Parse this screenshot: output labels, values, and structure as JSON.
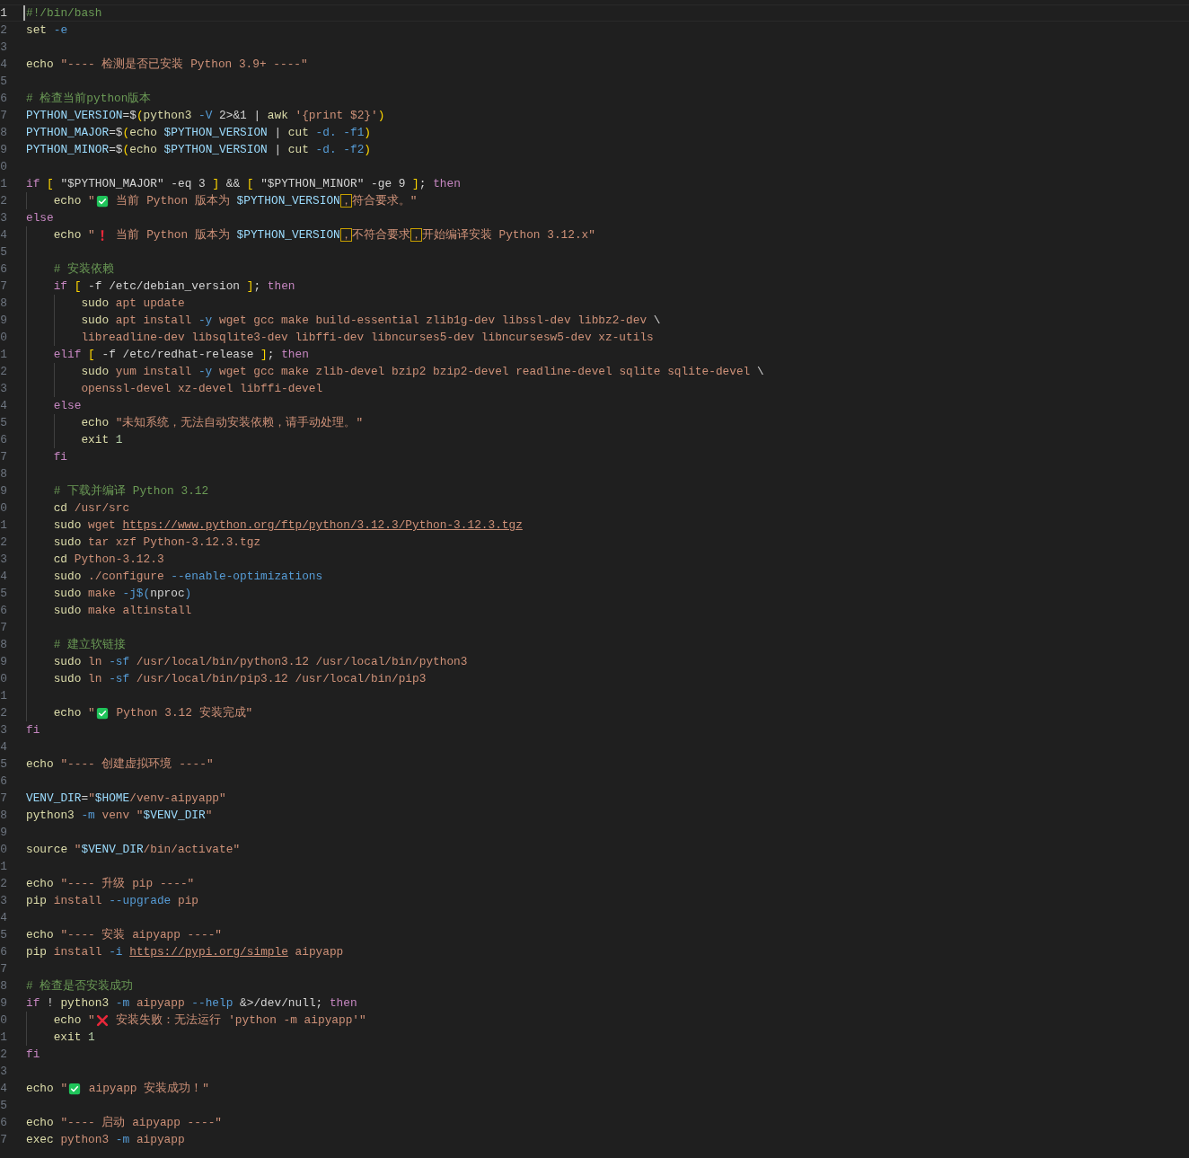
{
  "editor": {
    "lines": [
      {
        "number": "1",
        "current": true,
        "tokens": [
          {
            "kind": "comment",
            "text": "#!/bin/bash"
          }
        ]
      },
      {
        "number": "2",
        "tokens": [
          {
            "kind": "command",
            "text": "set "
          },
          {
            "kind": "option",
            "text": "-e"
          }
        ]
      },
      {
        "number": "3"
      },
      {
        "number": "4",
        "tokens": [
          {
            "kind": "command",
            "text": "echo "
          },
          {
            "kind": "string",
            "text": "\"---- 检测是否已安装 Python 3.9+ ----\""
          }
        ]
      },
      {
        "number": "5"
      },
      {
        "number": "6",
        "tokens": [
          {
            "kind": "comment",
            "text": "# 检查当前python版本"
          }
        ]
      },
      {
        "number": "7",
        "tokens": [
          {
            "kind": "variable",
            "text": "PYTHON_VERSION"
          },
          {
            "kind": "plain",
            "text": "=$"
          },
          {
            "kind": "bracket",
            "text": "("
          },
          {
            "kind": "command",
            "text": "python3 "
          },
          {
            "kind": "option",
            "text": "-V"
          },
          {
            "kind": "plain",
            "text": " 2>&1 | "
          },
          {
            "kind": "command",
            "text": "awk "
          },
          {
            "kind": "string",
            "text": "'{print $2}'"
          },
          {
            "kind": "bracket",
            "text": ")"
          }
        ]
      },
      {
        "number": "8",
        "tokens": [
          {
            "kind": "variable",
            "text": "PYTHON_MAJOR"
          },
          {
            "kind": "plain",
            "text": "=$"
          },
          {
            "kind": "bracket",
            "text": "("
          },
          {
            "kind": "command",
            "text": "echo "
          },
          {
            "kind": "variable",
            "text": "$PYTHON_VERSION"
          },
          {
            "kind": "plain",
            "text": " | "
          },
          {
            "kind": "command",
            "text": "cut "
          },
          {
            "kind": "option",
            "text": "-d. -f1"
          },
          {
            "kind": "bracket",
            "text": ")"
          }
        ]
      },
      {
        "number": "9",
        "tokens": [
          {
            "kind": "variable",
            "text": "PYTHON_MINOR"
          },
          {
            "kind": "plain",
            "text": "=$"
          },
          {
            "kind": "bracket",
            "text": "("
          },
          {
            "kind": "command",
            "text": "echo "
          },
          {
            "kind": "variable",
            "text": "$PYTHON_VERSION"
          },
          {
            "kind": "plain",
            "text": " | "
          },
          {
            "kind": "command",
            "text": "cut "
          },
          {
            "kind": "option",
            "text": "-d. -f2"
          },
          {
            "kind": "bracket",
            "text": ")"
          }
        ]
      },
      {
        "number": "0"
      },
      {
        "number": "1",
        "tokens": [
          {
            "kind": "keyword",
            "text": "if "
          },
          {
            "kind": "bracket",
            "text": "["
          },
          {
            "kind": "plain",
            "text": " \"$PYTHON_MAJOR\" -eq 3 "
          },
          {
            "kind": "bracket",
            "text": "]"
          },
          {
            "kind": "plain",
            "text": " && "
          },
          {
            "kind": "bracket",
            "text": "["
          },
          {
            "kind": "plain",
            "text": " \"$PYTHON_MINOR\" -ge 9 "
          },
          {
            "kind": "bracket",
            "text": "]"
          },
          {
            "kind": "plain",
            "text": "; "
          },
          {
            "kind": "keyword",
            "text": "then"
          }
        ],
        "children": [
          {
            "number": "2",
            "tokens": [
              {
                "kind": "command",
                "text": "echo "
              },
              {
                "kind": "string",
                "text": "\""
              },
              {
                "kind": "check_emoji"
              },
              {
                "kind": "string",
                "text": " 当前 Python 版本为 "
              },
              {
                "kind": "variable",
                "text": "$PYTHON_VERSION"
              },
              {
                "kind": "ambiguous",
                "text": "，"
              },
              {
                "kind": "string",
                "text": "符合要求。\""
              }
            ]
          }
        ]
      },
      {
        "number": "3",
        "tokens": [
          {
            "kind": "keyword",
            "text": "else"
          }
        ],
        "children": [
          {
            "number": "4",
            "tokens": [
              {
                "kind": "command",
                "text": "echo "
              },
              {
                "kind": "string",
                "text": "\""
              },
              {
                "kind": "exclaim_emoji"
              },
              {
                "kind": "string",
                "text": " 当前 Python 版本为 "
              },
              {
                "kind": "variable",
                "text": "$PYTHON_VERSION"
              },
              {
                "kind": "ambiguous",
                "text": "，"
              },
              {
                "kind": "string",
                "text": "不符合要求"
              },
              {
                "kind": "ambiguous",
                "text": "，"
              },
              {
                "kind": "string",
                "text": "开始编译安装 Python 3.12.x\""
              }
            ]
          },
          {
            "number": "5"
          },
          {
            "number": "6",
            "tokens": [
              {
                "kind": "comment",
                "text": "# 安装依赖"
              }
            ]
          },
          {
            "number": "7",
            "tokens": [
              {
                "kind": "keyword",
                "text": "if "
              },
              {
                "kind": "bracket",
                "text": "["
              },
              {
                "kind": "plain",
                "text": " -f /etc/debian_version "
              },
              {
                "kind": "bracket",
                "text": "]"
              },
              {
                "kind": "plain",
                "text": "; "
              },
              {
                "kind": "keyword",
                "text": "then"
              }
            ],
            "children": [
              {
                "number": "8",
                "tokens": [
                  {
                    "kind": "command",
                    "text": "sudo"
                  },
                  {
                    "kind": "string",
                    "text": " apt update"
                  }
                ]
              },
              {
                "number": "9",
                "tokens": [
                  {
                    "kind": "command",
                    "text": "sudo"
                  },
                  {
                    "kind": "string",
                    "text": " apt install "
                  },
                  {
                    "kind": "option",
                    "text": "-y"
                  },
                  {
                    "kind": "string",
                    "text": " wget gcc make build-essential zlib1g-dev libssl-dev libbz2-dev "
                  },
                  {
                    "kind": "plain",
                    "text": "\\"
                  }
                ]
              },
              {
                "number": "0",
                "tokens": [
                  {
                    "kind": "string",
                    "text": "libreadline-dev libsqlite3-dev libffi-dev libncurses5-dev libncursesw5-dev xz-utils"
                  }
                ]
              }
            ]
          },
          {
            "number": "1",
            "tokens": [
              {
                "kind": "keyword",
                "text": "elif "
              },
              {
                "kind": "bracket",
                "text": "["
              },
              {
                "kind": "plain",
                "text": " -f /etc/redhat-release "
              },
              {
                "kind": "bracket",
                "text": "]"
              },
              {
                "kind": "plain",
                "text": "; "
              },
              {
                "kind": "keyword",
                "text": "then"
              }
            ],
            "children": [
              {
                "number": "2",
                "tokens": [
                  {
                    "kind": "command",
                    "text": "sudo"
                  },
                  {
                    "kind": "string",
                    "text": " yum install "
                  },
                  {
                    "kind": "option",
                    "text": "-y"
                  },
                  {
                    "kind": "string",
                    "text": " wget gcc make zlib-devel bzip2 bzip2-devel readline-devel sqlite sqlite-devel "
                  },
                  {
                    "kind": "plain",
                    "text": "\\"
                  }
                ]
              },
              {
                "number": "3",
                "tokens": [
                  {
                    "kind": "string",
                    "text": "openssl-devel xz-devel libffi-devel"
                  }
                ]
              }
            ]
          },
          {
            "number": "4",
            "tokens": [
              {
                "kind": "keyword",
                "text": "else"
              }
            ],
            "children": [
              {
                "number": "5",
                "tokens": [
                  {
                    "kind": "command",
                    "text": "echo "
                  },
                  {
                    "kind": "string",
                    "text": "\"未知系统，无法自动安装依赖，请手动处理。\""
                  }
                ]
              },
              {
                "number": "6",
                "tokens": [
                  {
                    "kind": "command",
                    "text": "exit "
                  },
                  {
                    "kind": "number",
                    "text": "1"
                  }
                ]
              }
            ]
          },
          {
            "number": "7",
            "tokens": [
              {
                "kind": "keyword",
                "text": "fi"
              }
            ]
          },
          {
            "number": "8"
          },
          {
            "number": "9",
            "tokens": [
              {
                "kind": "comment",
                "text": "# 下载并编译 Python 3.12"
              }
            ]
          },
          {
            "number": "0",
            "tokens": [
              {
                "kind": "command",
                "text": "cd"
              },
              {
                "kind": "string",
                "text": " /usr/src"
              }
            ]
          },
          {
            "number": "1",
            "tokens": [
              {
                "kind": "command",
                "text": "sudo"
              },
              {
                "kind": "string",
                "text": " wget "
              },
              {
                "kind": "link",
                "text": "https://www.python.org/ftp/python/3.12.3/Python-3.12.3.tgz"
              }
            ]
          },
          {
            "number": "2",
            "tokens": [
              {
                "kind": "command",
                "text": "sudo"
              },
              {
                "kind": "string",
                "text": " tar xzf Python-3.12.3.tgz"
              }
            ]
          },
          {
            "number": "3",
            "tokens": [
              {
                "kind": "command",
                "text": "cd"
              },
              {
                "kind": "string",
                "text": " Python-3.12.3"
              }
            ]
          },
          {
            "number": "4",
            "tokens": [
              {
                "kind": "command",
                "text": "sudo"
              },
              {
                "kind": "string",
                "text": " ./configure "
              },
              {
                "kind": "option",
                "text": "--enable-optimizations"
              }
            ]
          },
          {
            "number": "5",
            "tokens": [
              {
                "kind": "command",
                "text": "sudo"
              },
              {
                "kind": "string",
                "text": " make "
              },
              {
                "kind": "option",
                "text": "-j$("
              },
              {
                "kind": "plain",
                "text": "nproc"
              },
              {
                "kind": "option",
                "text": ")"
              }
            ]
          },
          {
            "number": "6",
            "tokens": [
              {
                "kind": "command",
                "text": "sudo"
              },
              {
                "kind": "string",
                "text": " make altinstall"
              }
            ]
          },
          {
            "number": "7"
          },
          {
            "number": "8",
            "tokens": [
              {
                "kind": "comment",
                "text": "# 建立软链接"
              }
            ]
          },
          {
            "number": "9",
            "tokens": [
              {
                "kind": "command",
                "text": "sudo"
              },
              {
                "kind": "string",
                "text": " ln "
              },
              {
                "kind": "option",
                "text": "-sf"
              },
              {
                "kind": "string",
                "text": " /usr/local/bin/python3.12 /usr/local/bin/python3"
              }
            ]
          },
          {
            "number": "0",
            "tokens": [
              {
                "kind": "command",
                "text": "sudo"
              },
              {
                "kind": "string",
                "text": " ln "
              },
              {
                "kind": "option",
                "text": "-sf"
              },
              {
                "kind": "string",
                "text": " /usr/local/bin/pip3.12 /usr/local/bin/pip3"
              }
            ]
          },
          {
            "number": "1"
          },
          {
            "number": "2",
            "tokens": [
              {
                "kind": "command",
                "text": "echo "
              },
              {
                "kind": "string",
                "text": "\""
              },
              {
                "kind": "check_emoji"
              },
              {
                "kind": "string",
                "text": " Python 3.12 安装完成\""
              }
            ]
          }
        ]
      },
      {
        "number": "3",
        "tokens": [
          {
            "kind": "keyword",
            "text": "fi"
          }
        ]
      },
      {
        "number": "4"
      },
      {
        "number": "5",
        "tokens": [
          {
            "kind": "command",
            "text": "echo "
          },
          {
            "kind": "string",
            "text": "\"---- 创建虚拟环境 ----\""
          }
        ]
      },
      {
        "number": "6"
      },
      {
        "number": "7",
        "tokens": [
          {
            "kind": "variable",
            "text": "VENV_DIR"
          },
          {
            "kind": "plain",
            "text": "="
          },
          {
            "kind": "string",
            "text": "\""
          },
          {
            "kind": "variable",
            "text": "$HOME"
          },
          {
            "kind": "string",
            "text": "/venv-aipyapp\""
          }
        ]
      },
      {
        "number": "8",
        "tokens": [
          {
            "kind": "command",
            "text": "python3 "
          },
          {
            "kind": "option",
            "text": "-m"
          },
          {
            "kind": "string",
            "text": " venv \""
          },
          {
            "kind": "variable",
            "text": "$VENV_DIR"
          },
          {
            "kind": "string",
            "text": "\""
          }
        ]
      },
      {
        "number": "9"
      },
      {
        "number": "0",
        "tokens": [
          {
            "kind": "command",
            "text": "source "
          },
          {
            "kind": "string",
            "text": "\""
          },
          {
            "kind": "variable",
            "text": "$VENV_DIR"
          },
          {
            "kind": "string",
            "text": "/bin/activate\""
          }
        ]
      },
      {
        "number": "1"
      },
      {
        "number": "2",
        "tokens": [
          {
            "kind": "command",
            "text": "echo "
          },
          {
            "kind": "string",
            "text": "\"---- 升级 pip ----\""
          }
        ]
      },
      {
        "number": "3",
        "tokens": [
          {
            "kind": "command",
            "text": "pip"
          },
          {
            "kind": "string",
            "text": " install "
          },
          {
            "kind": "option",
            "text": "--upgrade"
          },
          {
            "kind": "string",
            "text": " pip"
          }
        ]
      },
      {
        "number": "4"
      },
      {
        "number": "5",
        "tokens": [
          {
            "kind": "command",
            "text": "echo "
          },
          {
            "kind": "string",
            "text": "\"---- 安装 aipyapp ----\""
          }
        ]
      },
      {
        "number": "6",
        "tokens": [
          {
            "kind": "command",
            "text": "pip"
          },
          {
            "kind": "string",
            "text": " install "
          },
          {
            "kind": "option",
            "text": "-i "
          },
          {
            "kind": "link",
            "text": "https://pypi.org/simple"
          },
          {
            "kind": "string",
            "text": " aipyapp"
          }
        ]
      },
      {
        "number": "7"
      },
      {
        "number": "8",
        "tokens": [
          {
            "kind": "comment",
            "text": "# 检查是否安装成功"
          }
        ]
      },
      {
        "number": "9",
        "tokens": [
          {
            "kind": "keyword",
            "text": "if"
          },
          {
            "kind": "plain",
            "text": " ! "
          },
          {
            "kind": "command",
            "text": "python3 "
          },
          {
            "kind": "option",
            "text": "-m"
          },
          {
            "kind": "string",
            "text": " aipyapp "
          },
          {
            "kind": "option",
            "text": "--help"
          },
          {
            "kind": "plain",
            "text": " &>/dev/null; "
          },
          {
            "kind": "keyword",
            "text": "then"
          }
        ],
        "children": [
          {
            "number": "0",
            "tokens": [
              {
                "kind": "command",
                "text": "echo "
              },
              {
                "kind": "string",
                "text": "\""
              },
              {
                "kind": "cross_emoji"
              },
              {
                "kind": "string",
                "text": " 安装失败：无法运行 'python -m aipyapp'\""
              }
            ]
          },
          {
            "number": "1",
            "tokens": [
              {
                "kind": "command",
                "text": "exit "
              },
              {
                "kind": "number",
                "text": "1"
              }
            ]
          }
        ]
      },
      {
        "number": "2",
        "tokens": [
          {
            "kind": "keyword",
            "text": "fi"
          }
        ]
      },
      {
        "number": "3"
      },
      {
        "number": "4",
        "tokens": [
          {
            "kind": "command",
            "text": "echo "
          },
          {
            "kind": "string",
            "text": "\""
          },
          {
            "kind": "check_emoji"
          },
          {
            "kind": "string",
            "text": " aipyapp 安装成功！\""
          }
        ]
      },
      {
        "number": "5"
      },
      {
        "number": "6",
        "tokens": [
          {
            "kind": "command",
            "text": "echo "
          },
          {
            "kind": "string",
            "text": "\"---- 启动 aipyapp ----\""
          }
        ]
      },
      {
        "number": "7",
        "tokens": [
          {
            "kind": "command",
            "text": "exec"
          },
          {
            "kind": "string",
            "text": " python3 "
          },
          {
            "kind": "option",
            "text": "-m"
          },
          {
            "kind": "string",
            "text": " aipyapp"
          }
        ]
      }
    ]
  }
}
